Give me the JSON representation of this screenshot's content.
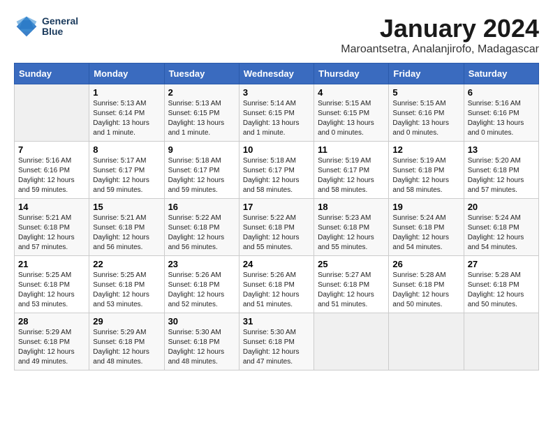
{
  "header": {
    "logo_line1": "General",
    "logo_line2": "Blue",
    "month": "January 2024",
    "location": "Maroantsetra, Analanjirofo, Madagascar"
  },
  "weekdays": [
    "Sunday",
    "Monday",
    "Tuesday",
    "Wednesday",
    "Thursday",
    "Friday",
    "Saturday"
  ],
  "weeks": [
    [
      {
        "day": "",
        "sunrise": "",
        "sunset": "",
        "daylight": ""
      },
      {
        "day": "1",
        "sunrise": "Sunrise: 5:13 AM",
        "sunset": "Sunset: 6:14 PM",
        "daylight": "Daylight: 13 hours and 1 minute."
      },
      {
        "day": "2",
        "sunrise": "Sunrise: 5:13 AM",
        "sunset": "Sunset: 6:15 PM",
        "daylight": "Daylight: 13 hours and 1 minute."
      },
      {
        "day": "3",
        "sunrise": "Sunrise: 5:14 AM",
        "sunset": "Sunset: 6:15 PM",
        "daylight": "Daylight: 13 hours and 1 minute."
      },
      {
        "day": "4",
        "sunrise": "Sunrise: 5:15 AM",
        "sunset": "Sunset: 6:15 PM",
        "daylight": "Daylight: 13 hours and 0 minutes."
      },
      {
        "day": "5",
        "sunrise": "Sunrise: 5:15 AM",
        "sunset": "Sunset: 6:16 PM",
        "daylight": "Daylight: 13 hours and 0 minutes."
      },
      {
        "day": "6",
        "sunrise": "Sunrise: 5:16 AM",
        "sunset": "Sunset: 6:16 PM",
        "daylight": "Daylight: 13 hours and 0 minutes."
      }
    ],
    [
      {
        "day": "7",
        "sunrise": "Sunrise: 5:16 AM",
        "sunset": "Sunset: 6:16 PM",
        "daylight": "Daylight: 12 hours and 59 minutes."
      },
      {
        "day": "8",
        "sunrise": "Sunrise: 5:17 AM",
        "sunset": "Sunset: 6:17 PM",
        "daylight": "Daylight: 12 hours and 59 minutes."
      },
      {
        "day": "9",
        "sunrise": "Sunrise: 5:18 AM",
        "sunset": "Sunset: 6:17 PM",
        "daylight": "Daylight: 12 hours and 59 minutes."
      },
      {
        "day": "10",
        "sunrise": "Sunrise: 5:18 AM",
        "sunset": "Sunset: 6:17 PM",
        "daylight": "Daylight: 12 hours and 58 minutes."
      },
      {
        "day": "11",
        "sunrise": "Sunrise: 5:19 AM",
        "sunset": "Sunset: 6:17 PM",
        "daylight": "Daylight: 12 hours and 58 minutes."
      },
      {
        "day": "12",
        "sunrise": "Sunrise: 5:19 AM",
        "sunset": "Sunset: 6:18 PM",
        "daylight": "Daylight: 12 hours and 58 minutes."
      },
      {
        "day": "13",
        "sunrise": "Sunrise: 5:20 AM",
        "sunset": "Sunset: 6:18 PM",
        "daylight": "Daylight: 12 hours and 57 minutes."
      }
    ],
    [
      {
        "day": "14",
        "sunrise": "Sunrise: 5:21 AM",
        "sunset": "Sunset: 6:18 PM",
        "daylight": "Daylight: 12 hours and 57 minutes."
      },
      {
        "day": "15",
        "sunrise": "Sunrise: 5:21 AM",
        "sunset": "Sunset: 6:18 PM",
        "daylight": "Daylight: 12 hours and 56 minutes."
      },
      {
        "day": "16",
        "sunrise": "Sunrise: 5:22 AM",
        "sunset": "Sunset: 6:18 PM",
        "daylight": "Daylight: 12 hours and 56 minutes."
      },
      {
        "day": "17",
        "sunrise": "Sunrise: 5:22 AM",
        "sunset": "Sunset: 6:18 PM",
        "daylight": "Daylight: 12 hours and 55 minutes."
      },
      {
        "day": "18",
        "sunrise": "Sunrise: 5:23 AM",
        "sunset": "Sunset: 6:18 PM",
        "daylight": "Daylight: 12 hours and 55 minutes."
      },
      {
        "day": "19",
        "sunrise": "Sunrise: 5:24 AM",
        "sunset": "Sunset: 6:18 PM",
        "daylight": "Daylight: 12 hours and 54 minutes."
      },
      {
        "day": "20",
        "sunrise": "Sunrise: 5:24 AM",
        "sunset": "Sunset: 6:18 PM",
        "daylight": "Daylight: 12 hours and 54 minutes."
      }
    ],
    [
      {
        "day": "21",
        "sunrise": "Sunrise: 5:25 AM",
        "sunset": "Sunset: 6:18 PM",
        "daylight": "Daylight: 12 hours and 53 minutes."
      },
      {
        "day": "22",
        "sunrise": "Sunrise: 5:25 AM",
        "sunset": "Sunset: 6:18 PM",
        "daylight": "Daylight: 12 hours and 53 minutes."
      },
      {
        "day": "23",
        "sunrise": "Sunrise: 5:26 AM",
        "sunset": "Sunset: 6:18 PM",
        "daylight": "Daylight: 12 hours and 52 minutes."
      },
      {
        "day": "24",
        "sunrise": "Sunrise: 5:26 AM",
        "sunset": "Sunset: 6:18 PM",
        "daylight": "Daylight: 12 hours and 51 minutes."
      },
      {
        "day": "25",
        "sunrise": "Sunrise: 5:27 AM",
        "sunset": "Sunset: 6:18 PM",
        "daylight": "Daylight: 12 hours and 51 minutes."
      },
      {
        "day": "26",
        "sunrise": "Sunrise: 5:28 AM",
        "sunset": "Sunset: 6:18 PM",
        "daylight": "Daylight: 12 hours and 50 minutes."
      },
      {
        "day": "27",
        "sunrise": "Sunrise: 5:28 AM",
        "sunset": "Sunset: 6:18 PM",
        "daylight": "Daylight: 12 hours and 50 minutes."
      }
    ],
    [
      {
        "day": "28",
        "sunrise": "Sunrise: 5:29 AM",
        "sunset": "Sunset: 6:18 PM",
        "daylight": "Daylight: 12 hours and 49 minutes."
      },
      {
        "day": "29",
        "sunrise": "Sunrise: 5:29 AM",
        "sunset": "Sunset: 6:18 PM",
        "daylight": "Daylight: 12 hours and 48 minutes."
      },
      {
        "day": "30",
        "sunrise": "Sunrise: 5:30 AM",
        "sunset": "Sunset: 6:18 PM",
        "daylight": "Daylight: 12 hours and 48 minutes."
      },
      {
        "day": "31",
        "sunrise": "Sunrise: 5:30 AM",
        "sunset": "Sunset: 6:18 PM",
        "daylight": "Daylight: 12 hours and 47 minutes."
      },
      {
        "day": "",
        "sunrise": "",
        "sunset": "",
        "daylight": ""
      },
      {
        "day": "",
        "sunrise": "",
        "sunset": "",
        "daylight": ""
      },
      {
        "day": "",
        "sunrise": "",
        "sunset": "",
        "daylight": ""
      }
    ]
  ]
}
